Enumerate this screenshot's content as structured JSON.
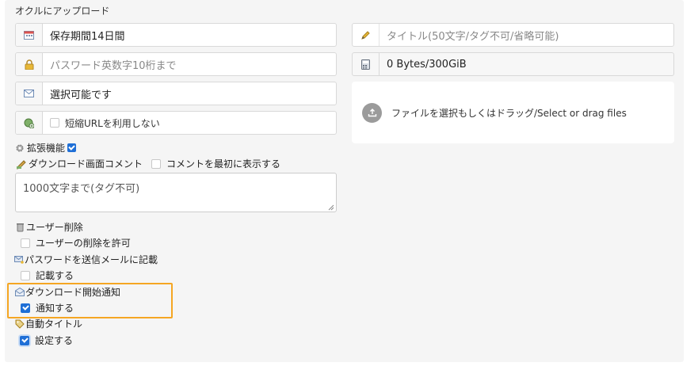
{
  "header": {
    "title": "オクルにアップロード"
  },
  "left_fields": {
    "retention": {
      "value": "保存期間14日間",
      "icon": "calendar-icon"
    },
    "password": {
      "placeholder": "パスワード英数字10桁まで",
      "icon": "lock-icon"
    },
    "email": {
      "value": "選択可能です",
      "icon": "envelope-icon"
    },
    "short_url": {
      "label": "短縮URLを利用しない",
      "checked": false,
      "icon": "globe-add-icon"
    }
  },
  "right_fields": {
    "title": {
      "placeholder": "タイトル(50文字/タグ不可/省略可能)",
      "icon": "pencil-icon"
    },
    "size": {
      "value": "0 Bytes/300GiB",
      "icon": "calculator-icon"
    }
  },
  "dropzone": {
    "label": "ファイルを選択もしくはドラッグ/Select or drag files",
    "icon": "upload-icon"
  },
  "extended": {
    "label": "拡張機能",
    "checked": true,
    "icon": "gear-icon"
  },
  "dl_comment": {
    "label": "ダウンロード画面コメント",
    "show_first_label": "コメントを最初に表示する",
    "show_first_checked": false,
    "placeholder": "1000文字まで(タグ不可)",
    "icon": "note-pencil-icon"
  },
  "user_delete": {
    "heading": "ユーザー削除",
    "option": "ユーザーの削除を許可",
    "checked": false,
    "icon": "trash-icon"
  },
  "mail_password": {
    "heading": "パスワードを送信メールに記載",
    "option": "記載する",
    "checked": false,
    "icon": "mail-key-icon"
  },
  "dl_notify": {
    "heading": "ダウンロード開始通知",
    "option": "通知する",
    "checked": true,
    "icon": "mail-open-icon"
  },
  "auto_title": {
    "heading": "自動タイトル",
    "option": "設定する",
    "checked": true,
    "icon": "tag-icon"
  },
  "colors": {
    "accent": "#1f6fd6",
    "highlight": "#f5a623",
    "panel": "#f5f5f5"
  }
}
